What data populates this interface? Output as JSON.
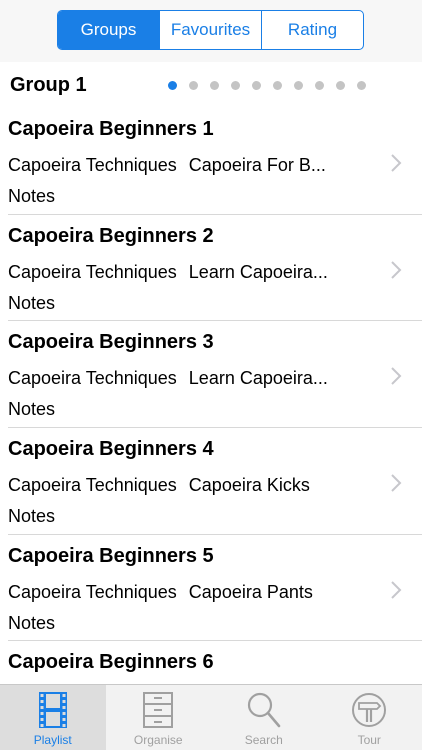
{
  "segments": [
    {
      "label": "Groups",
      "active": true
    },
    {
      "label": "Favourites",
      "active": false
    },
    {
      "label": "Rating",
      "active": false
    }
  ],
  "group": {
    "title": "Group 1",
    "page_count": 10,
    "current_page": 1
  },
  "rows": [
    {
      "title": "Capoeira Beginners 1",
      "tag1": "Capoeira Techniques",
      "tag2": "Capoeira For B...",
      "notes": "Notes"
    },
    {
      "title": "Capoeira Beginners 2",
      "tag1": "Capoeira Techniques",
      "tag2": "Learn Capoeira...",
      "notes": "Notes"
    },
    {
      "title": "Capoeira Beginners 3",
      "tag1": "Capoeira Techniques",
      "tag2": "Learn Capoeira...",
      "notes": "Notes"
    },
    {
      "title": "Capoeira Beginners 4",
      "tag1": "Capoeira Techniques",
      "tag2": "Capoeira Kicks",
      "notes": "Notes"
    },
    {
      "title": "Capoeira Beginners 5",
      "tag1": "Capoeira Techniques",
      "tag2": "Capoeira Pants",
      "notes": "Notes"
    },
    {
      "title": "Capoeira Beginners 6",
      "tag1": "",
      "tag2": "",
      "notes": ""
    }
  ],
  "tabs": [
    {
      "label": "Playlist",
      "icon": "film-strip-icon",
      "active": true
    },
    {
      "label": "Organise",
      "icon": "cabinet-icon",
      "active": false
    },
    {
      "label": "Search",
      "icon": "magnifier-icon",
      "active": false
    },
    {
      "label": "Tour",
      "icon": "signpost-icon",
      "active": false
    }
  ],
  "colors": {
    "accent": "#1a7fe6",
    "inactive_icon": "#a0a0a0",
    "separator": "#d8d8d8"
  }
}
